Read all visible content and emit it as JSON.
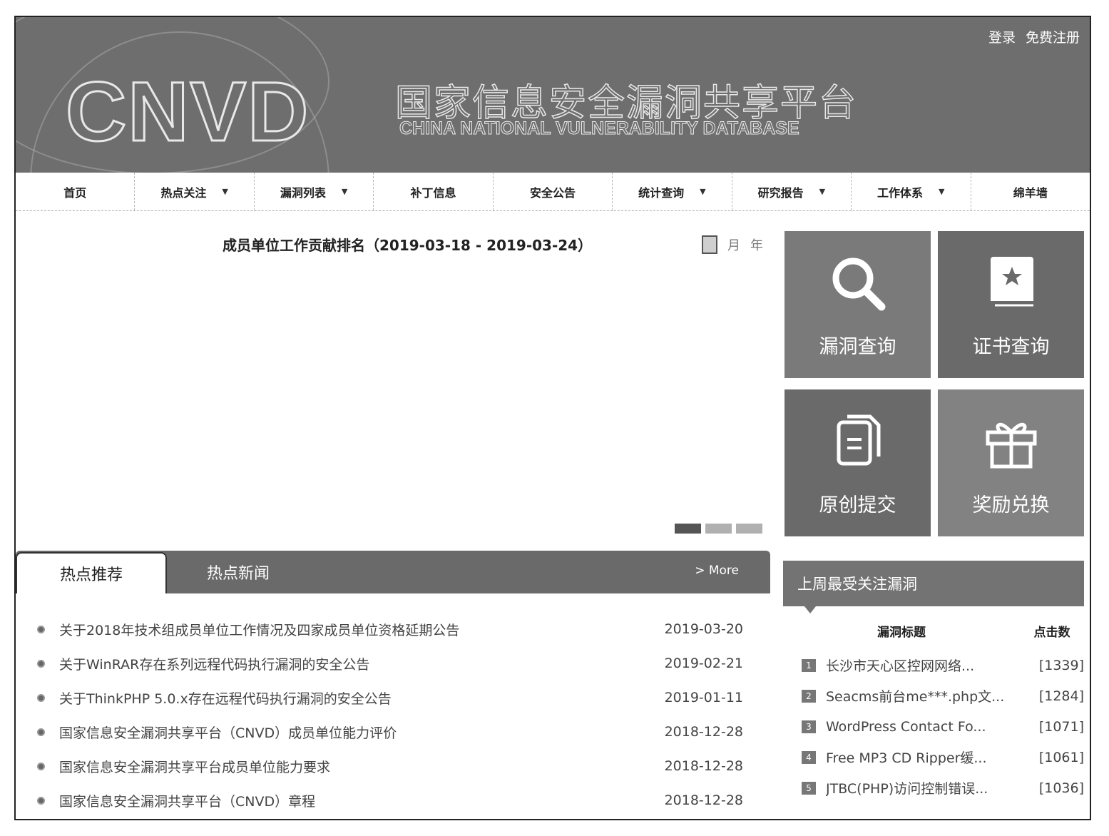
{
  "header": {
    "logo_text": "CNVD",
    "title": "国家信息安全漏洞共享平台",
    "subtitle": "CHINA NATIONAL VULNERABILITY DATABASE",
    "login": "登录",
    "register": "免费注册"
  },
  "nav": {
    "items": [
      {
        "label": "首页",
        "dropdown": false
      },
      {
        "label": "热点关注",
        "dropdown": true
      },
      {
        "label": "漏洞列表",
        "dropdown": true
      },
      {
        "label": "补丁信息",
        "dropdown": false
      },
      {
        "label": "安全公告",
        "dropdown": false
      },
      {
        "label": "统计查询",
        "dropdown": true
      },
      {
        "label": "研究报告",
        "dropdown": true
      },
      {
        "label": "工作体系",
        "dropdown": true
      },
      {
        "label": "绵羊墙",
        "dropdown": false
      }
    ]
  },
  "ranking": {
    "title": "成员单位工作贡献排名（2019-03-18 - 2019-03-24）",
    "month": "月",
    "year": "年",
    "slides": 3,
    "active_slide": 1
  },
  "tiles": {
    "vuln_query": "漏洞查询",
    "cert_query": "证书查询",
    "original_submit": "原创提交",
    "reward_exchange": "奖励兑换"
  },
  "news": {
    "tab_recommend": "热点推荐",
    "tab_news": "热点新闻",
    "more": "> More",
    "items": [
      {
        "title": "关于2018年技术组成员单位工作情况及四家成员单位资格延期公告",
        "date": "2019-03-20"
      },
      {
        "title": "关于WinRAR存在系列远程代码执行漏洞的安全公告",
        "date": "2019-02-21"
      },
      {
        "title": "关于ThinkPHP 5.0.x存在远程代码执行漏洞的安全公告",
        "date": "2019-01-11"
      },
      {
        "title": "国家信息安全漏洞共享平台（CNVD）成员单位能力评价",
        "date": "2018-12-28"
      },
      {
        "title": "国家信息安全漏洞共享平台成员单位能力要求",
        "date": "2018-12-28"
      },
      {
        "title": "国家信息安全漏洞共享平台（CNVD）章程",
        "date": "2018-12-28"
      }
    ]
  },
  "hot": {
    "title": "上周最受关注漏洞",
    "col_title": "漏洞标题",
    "col_clicks": "点击数",
    "items": [
      {
        "rank": "1",
        "title": "长沙市天心区控网网络...",
        "clicks": "[1339]"
      },
      {
        "rank": "2",
        "title": "Seacms前台me***.php文...",
        "clicks": "[1284]"
      },
      {
        "rank": "3",
        "title": "WordPress Contact Fo...",
        "clicks": "[1071]"
      },
      {
        "rank": "4",
        "title": "Free MP3 CD Ripper缓...",
        "clicks": "[1061]"
      },
      {
        "rank": "5",
        "title": "JTBC(PHP)访问控制错误...",
        "clicks": "[1036]"
      }
    ]
  }
}
